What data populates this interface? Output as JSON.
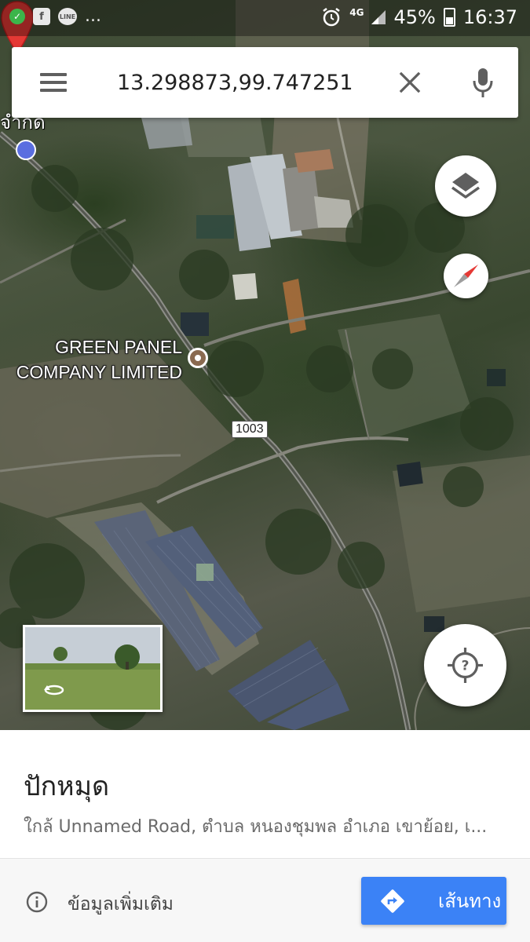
{
  "status_bar": {
    "notification_icons": [
      "check-circle-icon",
      "facebook-icon",
      "line-icon"
    ],
    "overflow": "...",
    "network": "4G",
    "battery": "45%",
    "time": "16:37"
  },
  "search": {
    "query": "13.298873,99.747251",
    "icons": [
      "menu-icon",
      "close-icon",
      "mic-icon"
    ]
  },
  "map": {
    "corner_label": "จํากด",
    "poi_label_line1": "GREEN PANEL",
    "poi_label_line2": "COMPANY LIMITED",
    "road_number": "1003",
    "icons": [
      "layers-icon",
      "compass-icon",
      "my-location-icon",
      "place-pin-icon",
      "street-view-icon"
    ]
  },
  "place": {
    "title": "ปักหมุด",
    "address": "ใกล้ Unnamed Road, ตําบล หนองชุมพล อําเภอ เขาย้อย, เ..."
  },
  "footer": {
    "more_info": "ข้อมูลเพิ่มเติม",
    "directions": "เส้นทาง"
  },
  "colors": {
    "accent": "#3b82f6",
    "pin": "#e53935",
    "poi_marker": "#8a6a50"
  }
}
